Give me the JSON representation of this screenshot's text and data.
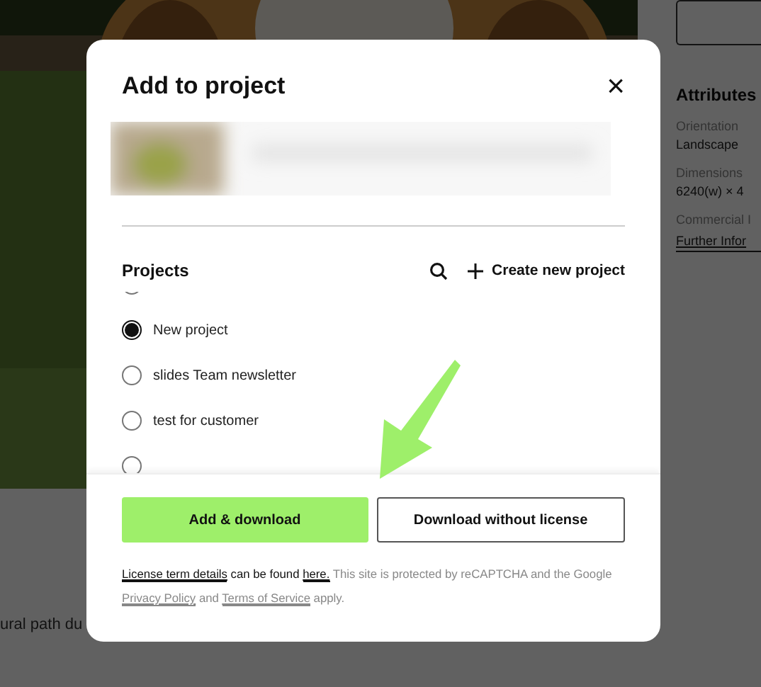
{
  "page": {
    "caption": "ural path du",
    "attributes": {
      "heading": "Attributes",
      "items": [
        {
          "label": "Orientation",
          "value": "Landscape"
        },
        {
          "label": "Dimensions",
          "value": "6240(w) × 4"
        },
        {
          "label": "Commercial I"
        }
      ],
      "link": "Further Infor"
    }
  },
  "dialog": {
    "title": "Add to project",
    "close": "×",
    "projects": {
      "heading": "Projects",
      "create": "Create new project",
      "items": [
        {
          "selected": false
        },
        {
          "label": "New project",
          "selected": true
        },
        {
          "label": "slides Team newsletter",
          "selected": false
        },
        {
          "label": "test for customer",
          "selected": false
        },
        {
          "selected": false
        }
      ]
    },
    "buttons": [
      {
        "label": "Add & download",
        "kind": "primary"
      },
      {
        "label": "Download without license",
        "kind": "secondary"
      }
    ],
    "legal": [
      {
        "kind": "link",
        "text": "License term details",
        "dark": true
      },
      {
        "kind": "text",
        "text": " can be found ",
        "dark": true
      },
      {
        "kind": "link",
        "text": "here.",
        "dark": true
      },
      {
        "kind": "text",
        "text": " This site is protected by reCAPTCHA and the Google ",
        "dark": false
      },
      {
        "kind": "link",
        "text": "Privacy Policy",
        "dark": false
      },
      {
        "kind": "text",
        "text": " and ",
        "dark": false
      },
      {
        "kind": "link",
        "text": "Terms of Service",
        "dark": false
      },
      {
        "kind": "text",
        "text": " apply.",
        "dark": false
      }
    ]
  }
}
